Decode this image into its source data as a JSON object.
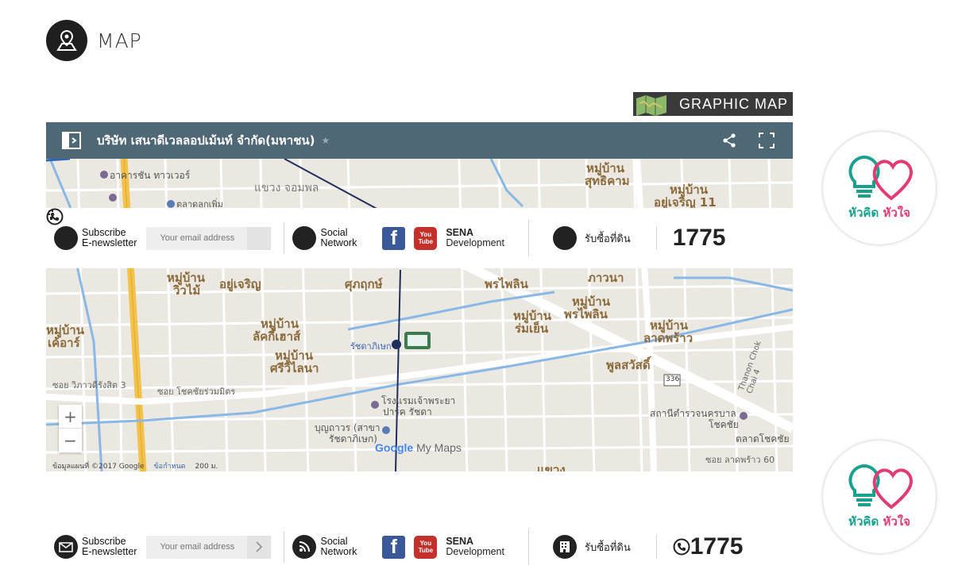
{
  "heading": {
    "title": "MAP",
    "icon": "map-pin-icon"
  },
  "graphic_map_button": {
    "label": "GRAPHIC MAP"
  },
  "map": {
    "title": "บริษัท เสนาดีเวลลอปเม้นท์ จำกัด(มหาชน)",
    "labels": {
      "l1": "อาคารชัน ทาวเวอร์",
      "l2": "ตลาดลูกเพิ่ม",
      "l3": "แขวง จอมพล",
      "l4": "หมู่บ้าน",
      "l5": "สุทธิคาม",
      "l6": "หมู่บ้าน",
      "l7": "อยู่เจริญ 11",
      "l8": "หมู่บ้าน",
      "l9": "วิวไม้",
      "l10": "อยู่เจริญ",
      "l11": "ศุภฤกษ์",
      "l12": "พรไพลิน",
      "l13": "ภาวนา",
      "l14": "หมู่บ้าน",
      "l15": "เค้อาร์",
      "l16": "ลัคกี้เฮาส์",
      "l17": "ศรีวิไลนา",
      "l18": "หมู่บ้าน",
      "l19": "ร่มเย็น",
      "l20": "พรไพลิน",
      "l21": "ลาดพร้าว",
      "l22": "พูลสวัสดิ์",
      "l23": "รัชดาภิเษก",
      "l24": "โรงแรมเจ้าพระยา",
      "l25": "ปาร์ค รัชดา",
      "l26": "บุญถาวร (สาขา",
      "l27": "รัชดาภิเษก)",
      "l28": "ซอย วิภาวดีรังสิต 3",
      "l29": "ซอย โชคชัยร่วมมิตร",
      "l30": "สถานีตำรวจนครบาล",
      "l31": "โชคชัย",
      "l32": "ตลาดโชคชัย",
      "l33": "ซอย ลาดพร้าว 60",
      "l34": "Thanon Chok Chai 4",
      "l35": "แขวง",
      "l36": "336",
      "l37": "หมู่บ้าน",
      "l38": "หมู่บ้าน",
      "l39": "หมู่บ้าน",
      "l40": "หมู่บ้าน",
      "l41": "หมู่บ้าน"
    },
    "zoom_in": "+",
    "zoom_out": "−",
    "attribution": "ข้อมูลแผนที่ ©2017 Google",
    "terms": "ข้อกำหนด",
    "scale": "200 ม.",
    "logo_google": "Google",
    "logo_mymaps": "My Maps"
  },
  "footer": {
    "subscribe_line1": "Subscribe",
    "subscribe_line2": "E-newsletter",
    "email_placeholder": "Your email address",
    "social_line1": "Social",
    "social_line2": "Network",
    "youtube_top": "You",
    "youtube_bottom": "Tube",
    "sena_line1": "SENA",
    "sena_line2": "Development",
    "buy_land": "รับซื้อที่ดิน",
    "hotline": "1775"
  },
  "badge": {
    "left": "หัวคิด",
    "right": "หัวใจ"
  },
  "colors": {
    "map_bar": "#4f6875",
    "badge_green": "#1aa08f",
    "badge_pink": "#e23b74"
  }
}
